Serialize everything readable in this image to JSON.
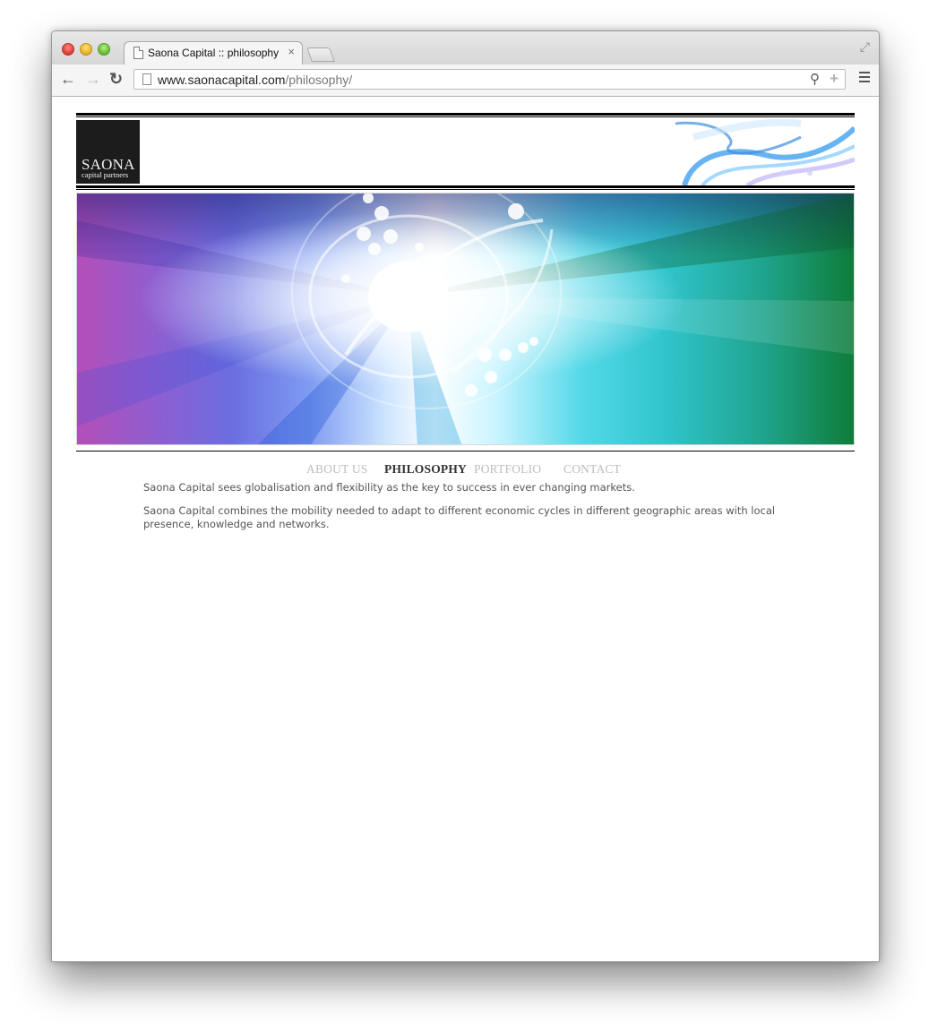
{
  "browser": {
    "tab_title": "Saona Capital :: philosophy",
    "tab_close": "×",
    "url_host": "www.saonacapital.com",
    "url_path": "/philosophy/",
    "icons": {
      "back": "back-arrow-icon",
      "forward": "forward-arrow-icon",
      "reload": "reload-icon",
      "search": "search-icon",
      "bookmark": "plus-icon",
      "menu": "hamburger-menu-icon",
      "fullscreen": "fullscreen-icon"
    }
  },
  "site": {
    "logo": {
      "main": "SAONA",
      "sub": "capital partners"
    },
    "nav": [
      {
        "label": "ABOUT US",
        "active": false
      },
      {
        "label": "PHILOSOPHY",
        "active": true
      },
      {
        "label": "PORTFOLIO",
        "active": false
      },
      {
        "label": "CONTACT",
        "active": false
      }
    ],
    "paragraphs": [
      "Saona Capital sees globalisation and flexibility as the key to success in ever changing markets.",
      "Saona Capital combines the mobility needed to adapt to different economic cycles in different geographic areas with local presence, knowledge and networks."
    ]
  },
  "colors": {
    "nav_inactive": "#bdbdbd",
    "nav_active": "#333333",
    "body_text": "#555555",
    "logo_bg": "#1c1c1c"
  }
}
